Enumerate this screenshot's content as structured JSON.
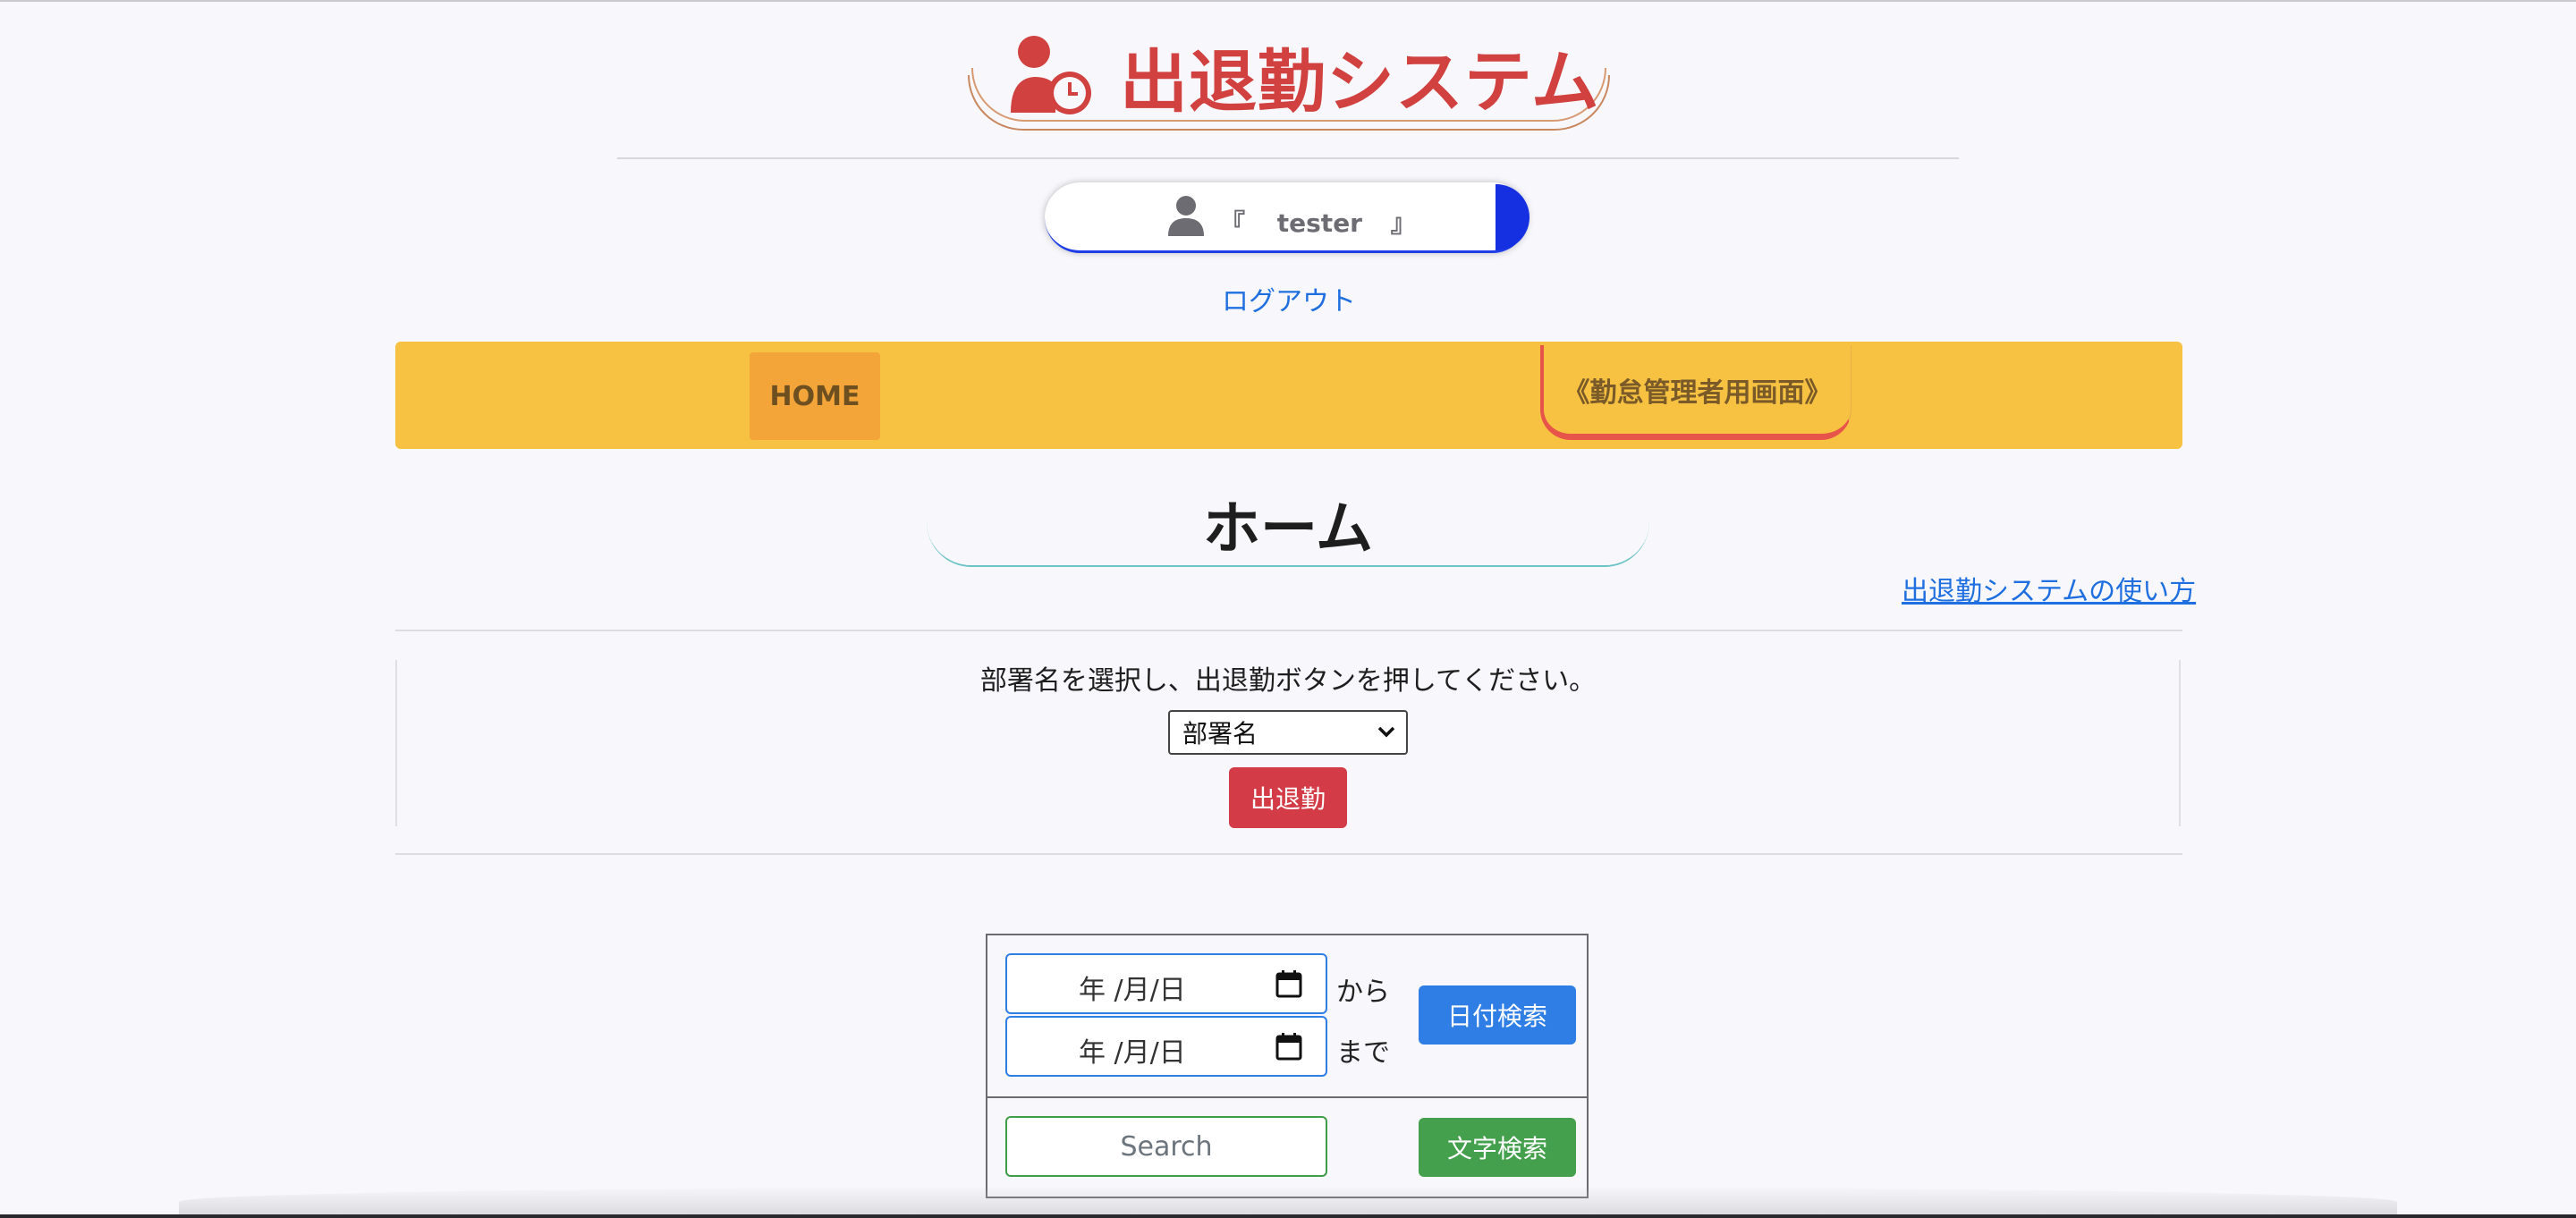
{
  "header": {
    "title": "出退勤システム",
    "title_icon": "user-clock-icon",
    "user_prefix": "『",
    "user_name": "tester",
    "user_suffix": "』",
    "logout": "ログアウト"
  },
  "nav": {
    "home": "HOME",
    "admin": "《勤怠管理者用画面》"
  },
  "page": {
    "title": "ホーム",
    "howto_link": "出退勤システムの使い方",
    "instruction": "部署名を選択し、出退勤ボタンを押してください。",
    "dept_select": "部署名",
    "clock_button": "出退勤"
  },
  "search": {
    "date_placeholder": "年 /月/日",
    "from_label": "から",
    "to_label": "まで",
    "date_button": "日付検索",
    "text_placeholder": "Search",
    "text_button": "文字検索"
  },
  "colors": {
    "title": "#d0413f",
    "nav_bar": "#f7c242",
    "link": "#1f6fe0",
    "primary": "#2f7ee6",
    "success": "#45a04d",
    "danger": "#d33c47"
  }
}
